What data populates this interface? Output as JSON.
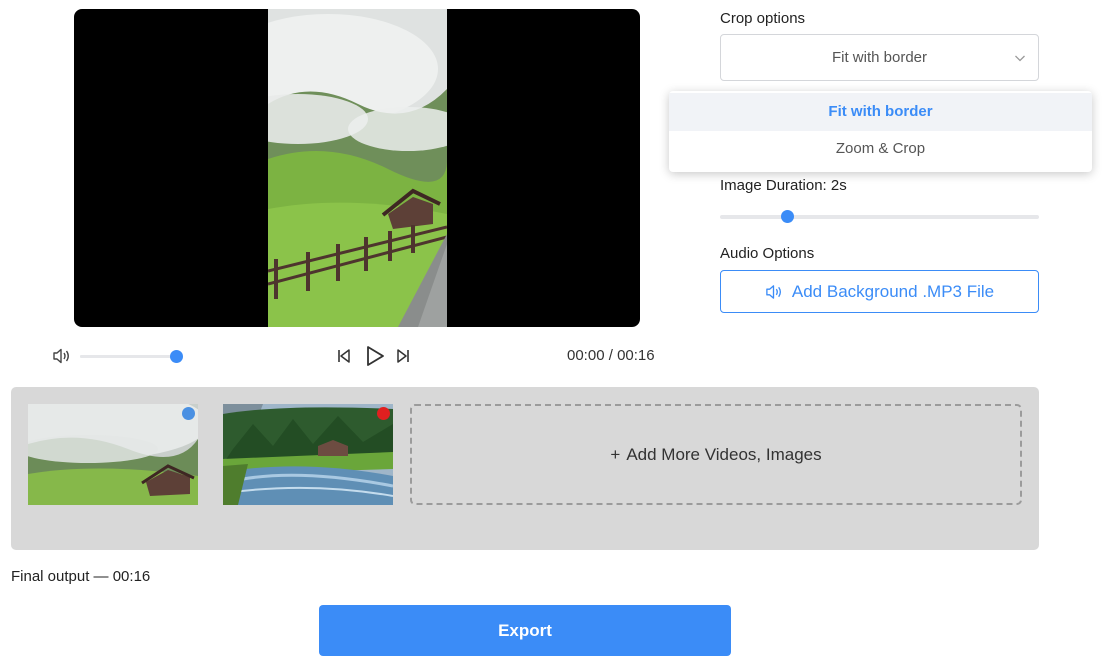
{
  "player": {
    "time_current": "00:00",
    "time_separator": "/",
    "time_total": "00:16",
    "volume_level": 1.0,
    "icons": {
      "volume": "volume-icon",
      "prev": "skip-back-icon",
      "play": "play-icon",
      "next": "skip-forward-icon"
    }
  },
  "crop": {
    "label": "Crop options",
    "selected": "Fit with border",
    "options": [
      "Fit with border",
      "Zoom & Crop"
    ]
  },
  "image_duration": {
    "label": "Image Duration: 2s",
    "slider_fraction": 0.21
  },
  "audio": {
    "label": "Audio Options",
    "button_label": "Add Background .MP3 File"
  },
  "timeline": {
    "add_more_label": "Add More Videos, Images",
    "items": [
      {
        "badge_color": "#4a90e2"
      },
      {
        "badge_color": "#e02020"
      }
    ]
  },
  "footer": {
    "final_output_label": "Final output — 00:16",
    "export_label": "Export"
  },
  "colors": {
    "accent": "#3b8cf7",
    "timeline_bg": "#d8d8d8"
  }
}
